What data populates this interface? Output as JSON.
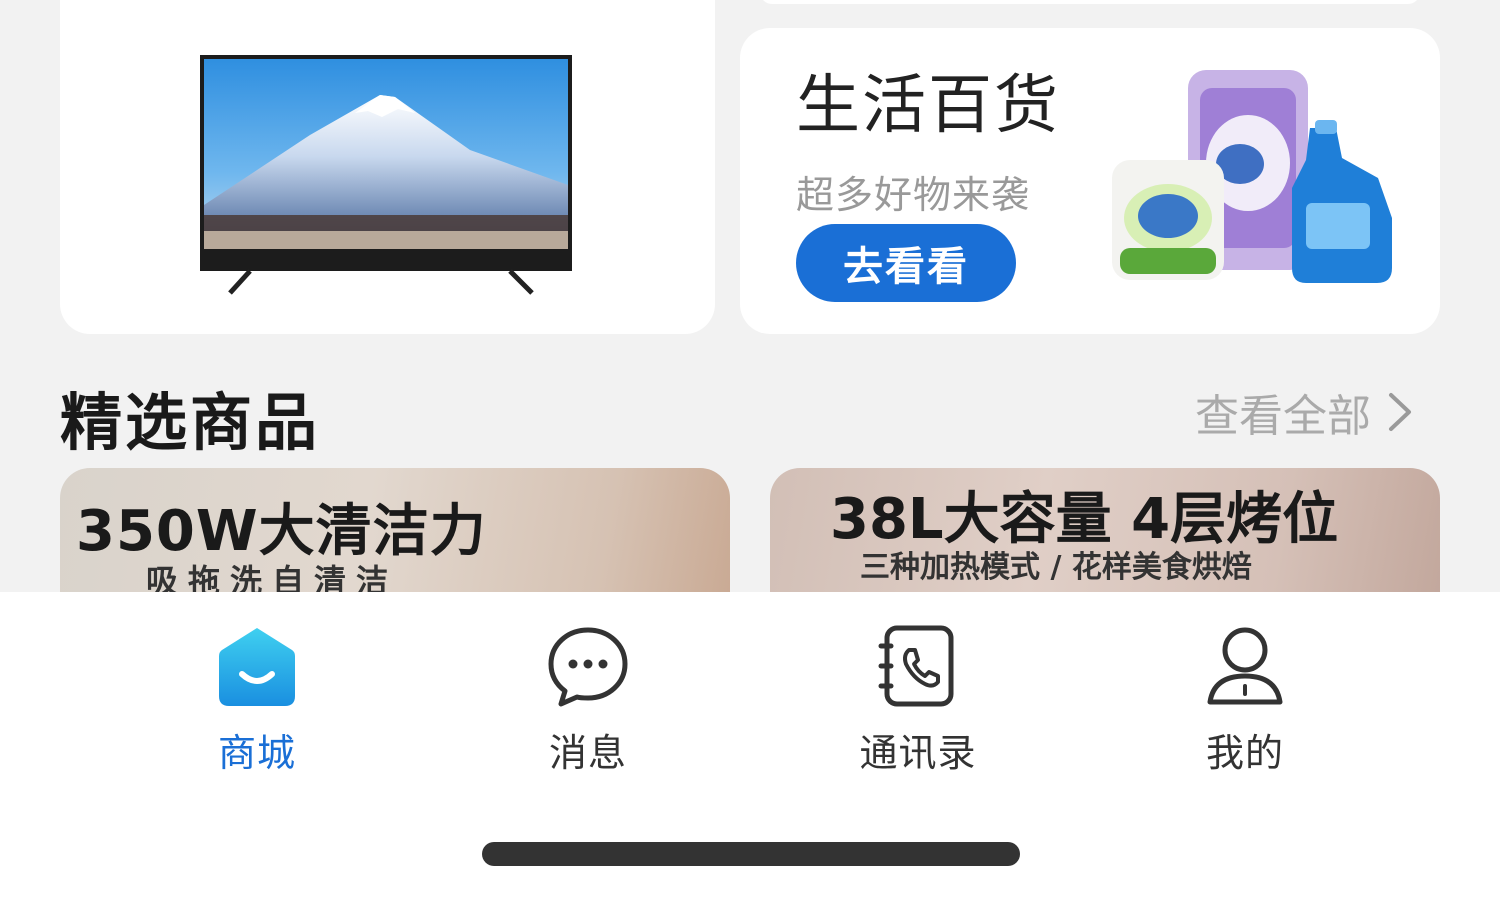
{
  "cards": {
    "daily": {
      "title": "生活百货",
      "subtitle": "超多好物来袭",
      "button": "去看看"
    }
  },
  "section": {
    "title": "精选商品",
    "view_all": "查看全部"
  },
  "products": [
    {
      "headline": "350W大清洁力",
      "sub": "吸拖洗自清洁"
    },
    {
      "headline": "38L大容量 4层烤位",
      "sub": "三种加热模式 / 花样美食烘焙"
    }
  ],
  "tabs": [
    {
      "label": "商城",
      "icon": "shop-icon",
      "active": true
    },
    {
      "label": "消息",
      "icon": "message-icon",
      "active": false
    },
    {
      "label": "通讯录",
      "icon": "contacts-icon",
      "active": false
    },
    {
      "label": "我的",
      "icon": "profile-icon",
      "active": false
    }
  ],
  "colors": {
    "accent": "#1a6fd6",
    "background": "#f2f2f2"
  }
}
